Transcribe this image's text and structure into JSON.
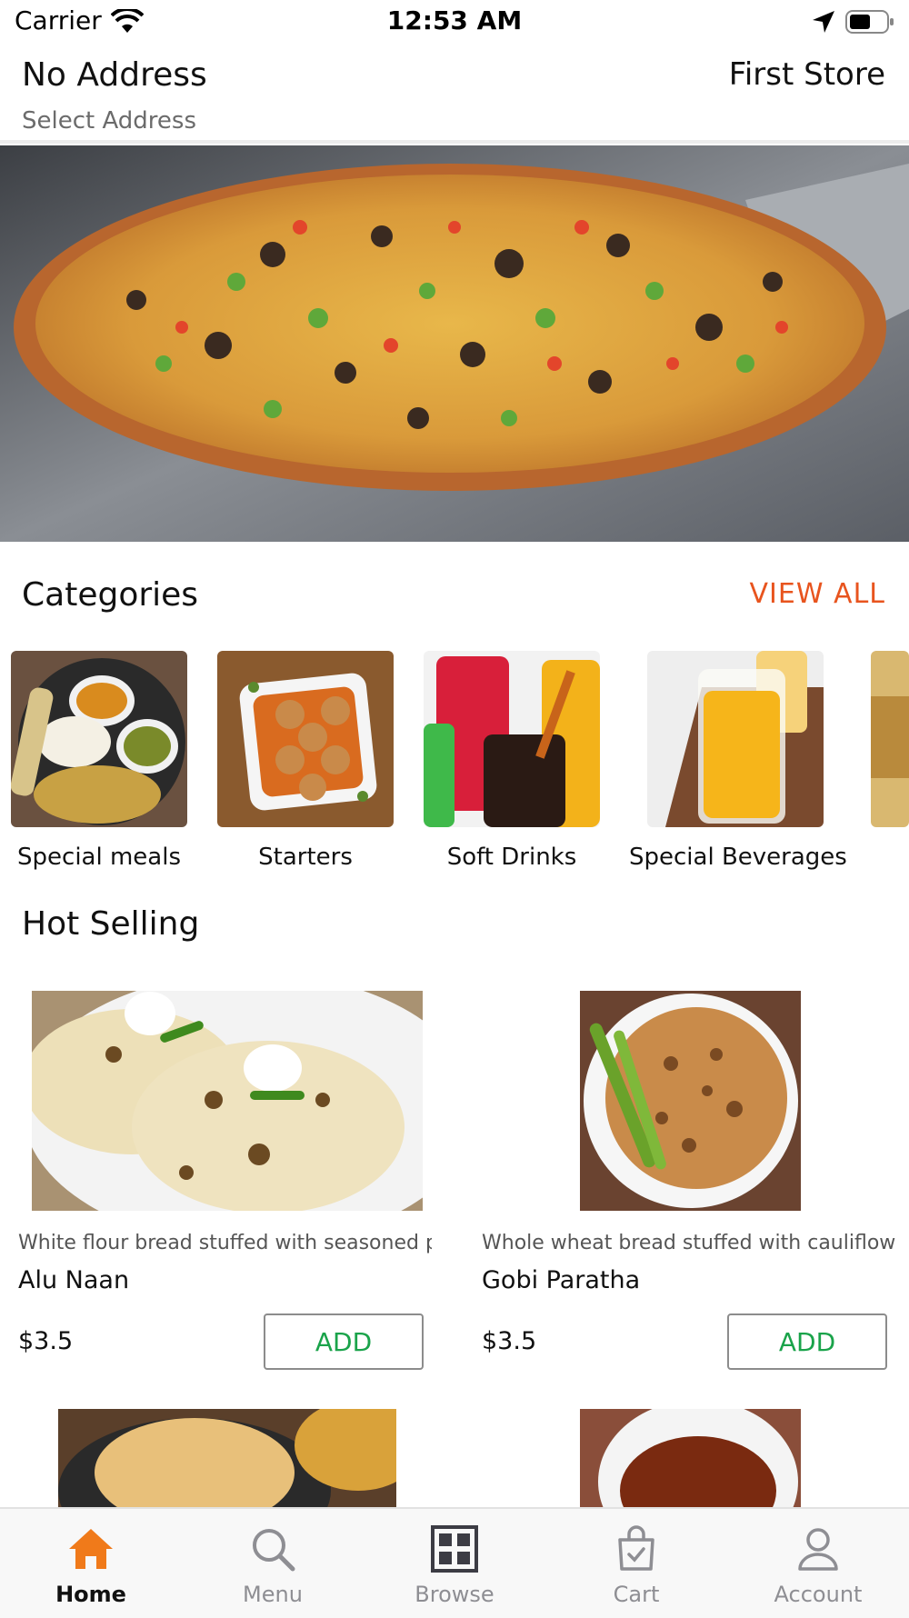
{
  "status_bar": {
    "carrier": "Carrier",
    "time": "12:53 AM"
  },
  "header": {
    "address_title": "No Address",
    "address_subtitle": "Select Address",
    "store_name": "First Store"
  },
  "categories": {
    "title": "Categories",
    "view_all": "VIEW ALL",
    "items": [
      {
        "label": "Special meals"
      },
      {
        "label": "Starters"
      },
      {
        "label": "Soft Drinks"
      },
      {
        "label": "Special Beverages"
      }
    ]
  },
  "hot_selling": {
    "title": "Hot Selling",
    "products": [
      {
        "description": "White flour bread stuffed with seasoned p",
        "name": "Alu Naan",
        "price": "$3.5",
        "add_label": "ADD"
      },
      {
        "description": "Whole wheat bread stuffed with cauliflowe",
        "name": "Gobi Paratha",
        "price": "$3.5",
        "add_label": "ADD"
      }
    ]
  },
  "bottom_nav": {
    "items": [
      {
        "label": "Home",
        "icon": "home-icon",
        "active": true
      },
      {
        "label": "Menu",
        "icon": "search-icon",
        "active": false
      },
      {
        "label": "Browse",
        "icon": "grid-icon",
        "active": false
      },
      {
        "label": "Cart",
        "icon": "shopping-bag-icon",
        "active": false
      },
      {
        "label": "Account",
        "icon": "user-icon",
        "active": false
      }
    ]
  },
  "colors": {
    "accent": "#e8541e",
    "add_green": "#1aa34a",
    "nav_active_icon": "#f07a1a",
    "nav_inactive": "#8e8e93"
  }
}
